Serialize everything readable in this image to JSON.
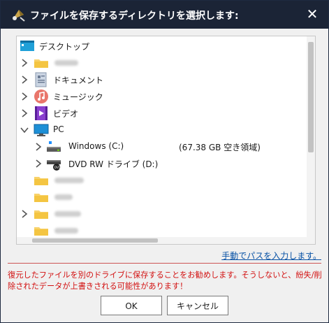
{
  "dialog": {
    "title": "ファイルを保存するディレクトリを選択します:"
  },
  "tree": {
    "desktop": "デスクトップ",
    "user_folder": "",
    "documents": "ドキュメント",
    "music": "ミュージック",
    "videos": "ビデオ",
    "pc": "PC",
    "drive_c": "Windows (C:)",
    "drive_c_free": "(67.38 GB 空き領域)",
    "drive_d": "DVD RW ドライブ (D:)"
  },
  "manual_link": "手動でパスを入力します。",
  "warning": "復元したファイルを別のドライブに保存することをお勧めします。そうしないと、紛失/削除されたデータが上書きされる可能性があります！",
  "buttons": {
    "ok": "OK",
    "cancel": "キャンセル"
  },
  "colors": {
    "titlebar": "#1b2436",
    "warning": "#d21010",
    "link": "#0a53a6"
  }
}
